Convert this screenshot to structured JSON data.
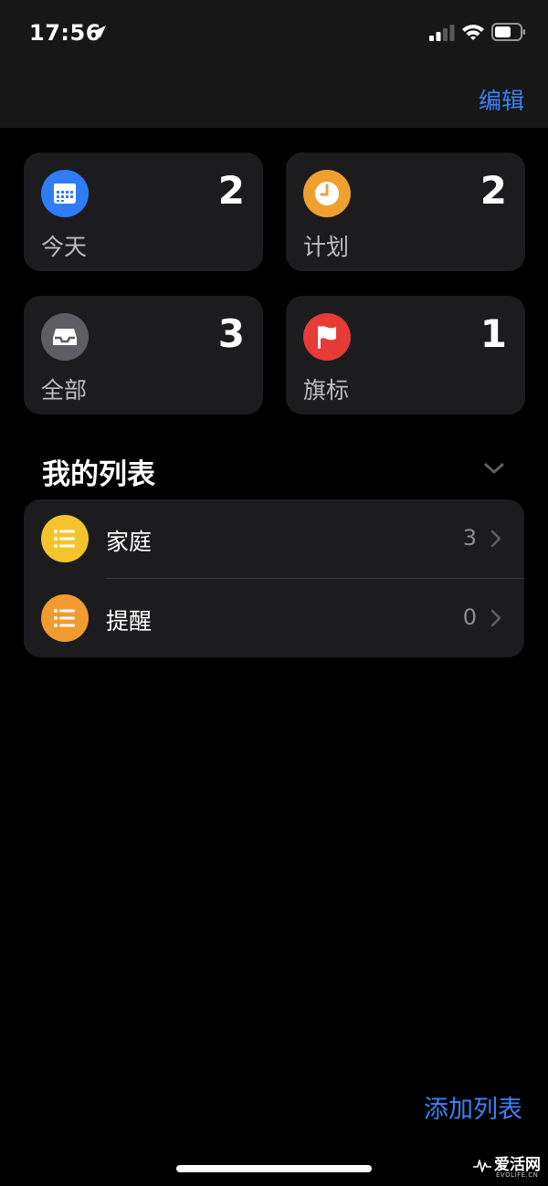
{
  "status_bar": {
    "time": "17:56",
    "location_icon": "location-arrow-icon",
    "signal_icon": "cellular-signal-icon",
    "wifi_icon": "wifi-icon",
    "battery_icon": "battery-icon"
  },
  "nav": {
    "edit_label": "编辑"
  },
  "smart_lists": [
    {
      "label": "今天",
      "count": "2",
      "icon": "calendar-icon",
      "color": "#2f7cf6"
    },
    {
      "label": "计划",
      "count": "2",
      "icon": "clock-icon",
      "color": "#f0a030"
    },
    {
      "label": "全部",
      "count": "3",
      "icon": "tray-icon",
      "color": "#5d5d63"
    },
    {
      "label": "旗标",
      "count": "1",
      "icon": "flag-icon",
      "color": "#e63b36"
    }
  ],
  "my_lists": {
    "title": "我的列表",
    "items": [
      {
        "label": "家庭",
        "count": "3",
        "icon": "list-icon",
        "color": "#f5c42c"
      },
      {
        "label": "提醒",
        "count": "0",
        "icon": "list-icon",
        "color": "#f29a30"
      }
    ]
  },
  "footer": {
    "add_list_label": "添加列表"
  },
  "watermark": {
    "name": "爱活网",
    "site": "EVOLIFE.CN"
  },
  "colors": {
    "accent": "#3b82f6",
    "background": "#000000",
    "card": "#1c1c1e"
  }
}
